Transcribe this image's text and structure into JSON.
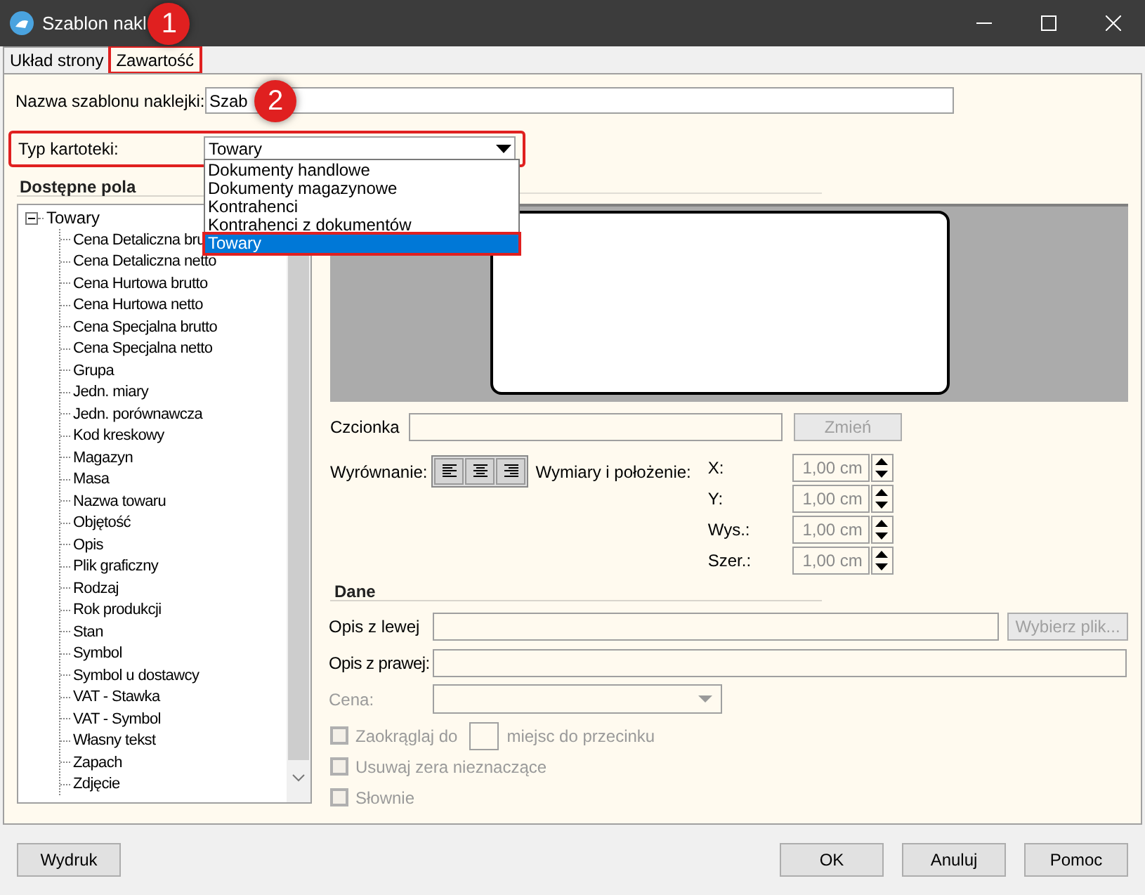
{
  "window": {
    "title": "Szablon nakl"
  },
  "annotations": [
    {
      "label": "1"
    },
    {
      "label": "2"
    }
  ],
  "tabs": [
    {
      "label": "Układ strony",
      "selected": false,
      "highlighted": false
    },
    {
      "label": "Zawartość",
      "selected": true,
      "highlighted": true
    }
  ],
  "name_field": {
    "label": "Nazwa szablonu naklejki:",
    "value": "Szab"
  },
  "type_field": {
    "label": "Typ kartoteki:",
    "value": "Towary",
    "highlighted": true,
    "expanded": true,
    "options": [
      {
        "label": "Dokumenty handlowe",
        "selected": false,
        "highlighted": false
      },
      {
        "label": "Dokumenty magazynowe",
        "selected": false,
        "highlighted": false
      },
      {
        "label": "Kontrahenci",
        "selected": false,
        "highlighted": false
      },
      {
        "label": "Kontrahenci z dokumentów",
        "selected": false,
        "highlighted": false
      },
      {
        "label": "Towary",
        "selected": true,
        "highlighted": true
      }
    ]
  },
  "fields_panel": {
    "title": "Dostępne pola",
    "tree": [
      {
        "label": "Towary",
        "expanded": true,
        "children": [
          {
            "label": "Cena Detaliczna bru"
          },
          {
            "label": "Cena Detaliczna netto"
          },
          {
            "label": "Cena Hurtowa brutto"
          },
          {
            "label": "Cena Hurtowa netto"
          },
          {
            "label": "Cena Specjalna brutto"
          },
          {
            "label": "Cena Specjalna netto"
          },
          {
            "label": "Grupa"
          },
          {
            "label": "Jedn. miary"
          },
          {
            "label": "Jedn. porównawcza"
          },
          {
            "label": "Kod kreskowy"
          },
          {
            "label": "Magazyn"
          },
          {
            "label": "Masa"
          },
          {
            "label": "Nazwa towaru"
          },
          {
            "label": "Objętość"
          },
          {
            "label": "Opis"
          },
          {
            "label": "Plik graficzny"
          },
          {
            "label": "Rodzaj"
          },
          {
            "label": "Rok produkcji"
          },
          {
            "label": "Stan"
          },
          {
            "label": "Symbol"
          },
          {
            "label": "Symbol u dostawcy"
          },
          {
            "label": "VAT - Stawka"
          },
          {
            "label": "VAT - Symbol"
          },
          {
            "label": "Własny tekst"
          },
          {
            "label": "Zapach"
          },
          {
            "label": "Zdjęcie"
          }
        ]
      }
    ]
  },
  "font": {
    "label": "Czcionka",
    "button": "Zmień",
    "button_disabled": true
  },
  "alignment": {
    "label": "Wyrównanie:",
    "buttons": [
      {
        "kind": "left"
      },
      {
        "kind": "center"
      },
      {
        "kind": "right"
      }
    ]
  },
  "dimensions": {
    "label": "Wymiary i położenie:",
    "disabled": true,
    "fields": [
      {
        "label": "X:",
        "value": "1,00 cm"
      },
      {
        "label": "Y:",
        "value": "1,00 cm"
      },
      {
        "label": "Wys.:",
        "value": "1,00 cm"
      },
      {
        "label": "Szer.:",
        "value": "1,00 cm"
      }
    ]
  },
  "data_section": {
    "title": "Dane",
    "left_description": {
      "label": "Opis z lewej",
      "button": "Wybierz plik...",
      "button_disabled": true
    },
    "right_description": {
      "label": "Opis z prawej:"
    },
    "price": {
      "label": "Cena:",
      "disabled": true
    },
    "checkboxes": [
      {
        "kind": "round",
        "label": "Zaokrąglaj do",
        "suffix": "miejsc do przecinku",
        "checked": false,
        "disabled": true
      },
      {
        "kind": "plain",
        "label": "Usuwaj zera nieznaczące",
        "checked": false,
        "disabled": true
      },
      {
        "kind": "plain",
        "label": "Słownie",
        "checked": false,
        "disabled": true
      }
    ]
  },
  "buttons": [
    {
      "label": "Wydruk"
    },
    {
      "label": "OK"
    },
    {
      "label": "Anuluj"
    },
    {
      "label": "Pomoc"
    }
  ]
}
